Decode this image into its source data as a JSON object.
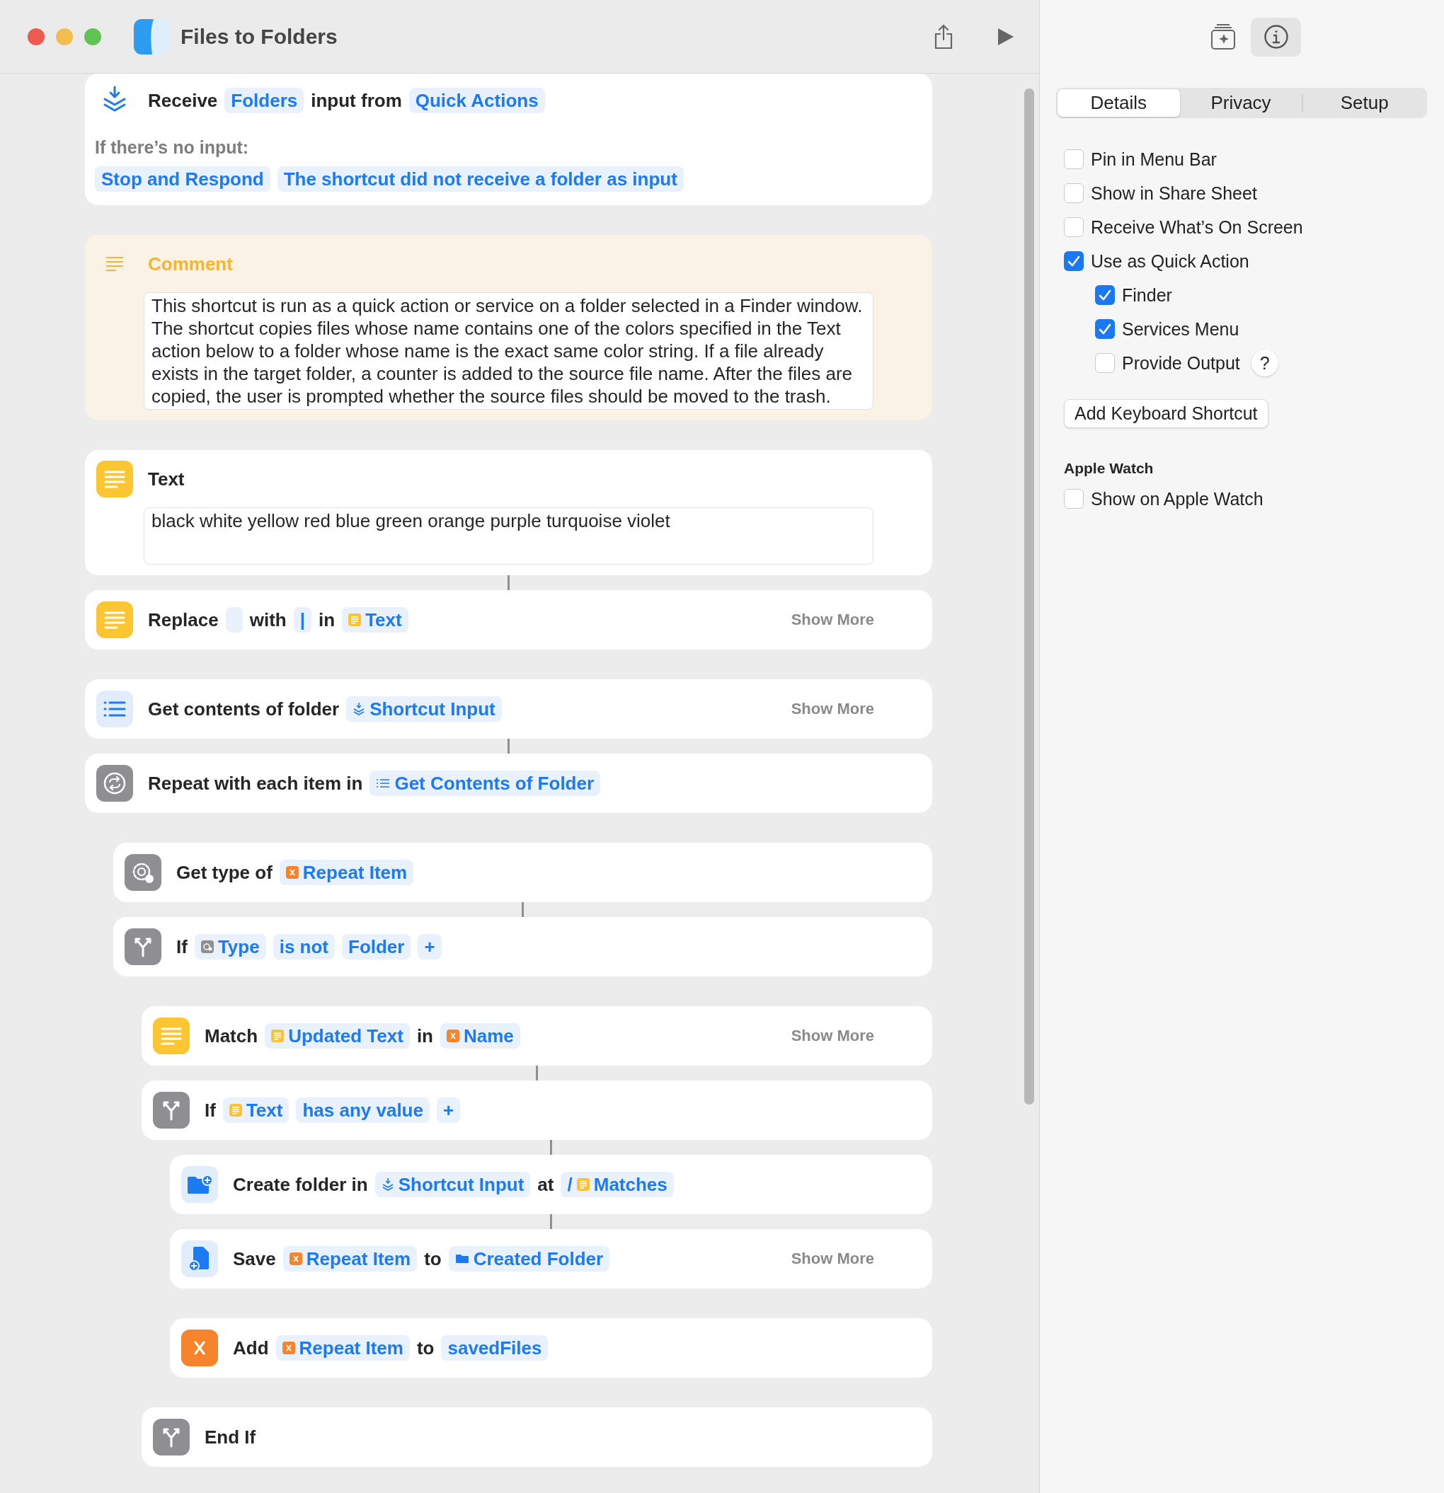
{
  "window": {
    "title": "Files to Folders"
  },
  "actions": [
    {
      "kind": "receive",
      "connected": false,
      "parts": [
        {
          "kind": "label",
          "text": "Receive"
        },
        {
          "kind": "token",
          "text": "Folders"
        },
        {
          "kind": "label",
          "text": "input from"
        },
        {
          "kind": "token",
          "text": "Quick Actions"
        }
      ],
      "fallback_label": "If there’s no input:",
      "fallback_parts": [
        {
          "kind": "token",
          "text": "Stop and Respond"
        },
        {
          "kind": "token",
          "text": "The shortcut did not receive a folder as input"
        }
      ]
    },
    {
      "kind": "comment",
      "connected": false,
      "title": "Comment",
      "body": "This shortcut is run as a quick action or service on a folder selected in a Finder window. The shortcut copies files whose name contains one of the colors specified in the Text action below to a folder whose name is the exact same color string. If a file already exists in the target folder, a counter is added to the source file name. After the files are copied, the user is prompted whether the source files should be moved to the trash."
    },
    {
      "kind": "text",
      "connected": false,
      "title": "Text",
      "body": "black white yellow red blue green orange purple turquoise violet"
    },
    {
      "kind": "replace",
      "connected": true,
      "parts": [
        {
          "kind": "label",
          "text": "Replace"
        },
        {
          "kind": "empty"
        },
        {
          "kind": "label",
          "text": "with"
        },
        {
          "kind": "token",
          "text": "|"
        },
        {
          "kind": "label",
          "text": "in"
        },
        {
          "kind": "text-token",
          "text": "Text"
        }
      ],
      "show_more": "Show More"
    },
    {
      "kind": "list",
      "connected": false,
      "parts": [
        {
          "kind": "label",
          "text": "Get contents of folder"
        },
        {
          "kind": "input-token",
          "text": "Shortcut Input"
        }
      ],
      "show_more": "Show More"
    },
    {
      "kind": "repeat",
      "connected": true,
      "parts": [
        {
          "kind": "label",
          "text": "Repeat with each item in"
        },
        {
          "kind": "list-token",
          "text": "Get Contents of Folder"
        }
      ],
      "children": [
        {
          "kind": "type",
          "connected": false,
          "parts": [
            {
              "kind": "label",
              "text": "Get type of"
            },
            {
              "kind": "variable-token",
              "text": "Repeat Item"
            }
          ]
        },
        {
          "kind": "if",
          "connected": true,
          "parts": [
            {
              "kind": "label",
              "text": "If"
            },
            {
              "kind": "type-token",
              "text": "Type"
            },
            {
              "kind": "token",
              "text": "is not"
            },
            {
              "kind": "token",
              "text": "Folder"
            },
            {
              "kind": "token",
              "text": "+"
            }
          ],
          "children": [
            {
              "kind": "match",
              "connected": false,
              "parts": [
                {
                  "kind": "label",
                  "text": "Match"
                },
                {
                  "kind": "text-token",
                  "text": "Updated Text"
                },
                {
                  "kind": "label",
                  "text": "in"
                },
                {
                  "kind": "variable-token",
                  "text": "Name"
                }
              ],
              "show_more": "Show More"
            },
            {
              "kind": "if",
              "connected": true,
              "parts": [
                {
                  "kind": "label",
                  "text": "If"
                },
                {
                  "kind": "text-token",
                  "text": "Text"
                },
                {
                  "kind": "token",
                  "text": "has any value"
                },
                {
                  "kind": "token",
                  "text": "+"
                }
              ],
              "children": [
                {
                  "kind": "create-folder",
                  "connected": true,
                  "parts": [
                    {
                      "kind": "label",
                      "text": "Create folder in"
                    },
                    {
                      "kind": "input-token",
                      "text": "Shortcut Input"
                    },
                    {
                      "kind": "label",
                      "text": "at"
                    },
                    {
                      "kind": "text-token",
                      "prefix": "/",
                      "text": "Matches"
                    }
                  ]
                },
                {
                  "kind": "save",
                  "connected": true,
                  "parts": [
                    {
                      "kind": "label",
                      "text": "Save"
                    },
                    {
                      "kind": "variable-token",
                      "text": "Repeat Item"
                    },
                    {
                      "kind": "label",
                      "text": "to"
                    },
                    {
                      "kind": "folder-token",
                      "text": "Created Folder"
                    }
                  ],
                  "show_more": "Show More"
                },
                {
                  "kind": "variable",
                  "connected": false,
                  "parts": [
                    {
                      "kind": "label",
                      "text": "Add"
                    },
                    {
                      "kind": "variable-token",
                      "text": "Repeat Item"
                    },
                    {
                      "kind": "label",
                      "text": "to"
                    },
                    {
                      "kind": "token",
                      "text": "savedFiles"
                    }
                  ]
                }
              ]
            },
            {
              "kind": "end-if",
              "connected": false,
              "parts": [
                {
                  "kind": "label",
                  "text": "End If"
                }
              ]
            }
          ]
        }
      ]
    }
  ],
  "inspector": {
    "tools": [
      {
        "kind": "gallery",
        "selected": false
      },
      {
        "kind": "info",
        "selected": true
      }
    ],
    "tabs": [
      {
        "label": "Details",
        "selected": true
      },
      {
        "label": "Privacy",
        "selected": false
      },
      {
        "label": "Setup",
        "selected": false
      }
    ],
    "options": [
      {
        "label": "Pin in Menu Bar",
        "checked": false
      },
      {
        "label": "Show in Share Sheet",
        "checked": false
      },
      {
        "label": "Receive What’s On Screen",
        "checked": false
      },
      {
        "label": "Use as Quick Action",
        "checked": true,
        "children": [
          {
            "label": "Finder",
            "checked": true
          },
          {
            "label": "Services Menu",
            "checked": true
          },
          {
            "label": "Provide Output",
            "checked": false,
            "help": "?"
          }
        ]
      }
    ],
    "button": "Add Keyboard Shortcut",
    "sections": [
      {
        "title": "Apple Watch",
        "options": [
          {
            "label": "Show on Apple Watch",
            "checked": false
          }
        ]
      }
    ]
  }
}
